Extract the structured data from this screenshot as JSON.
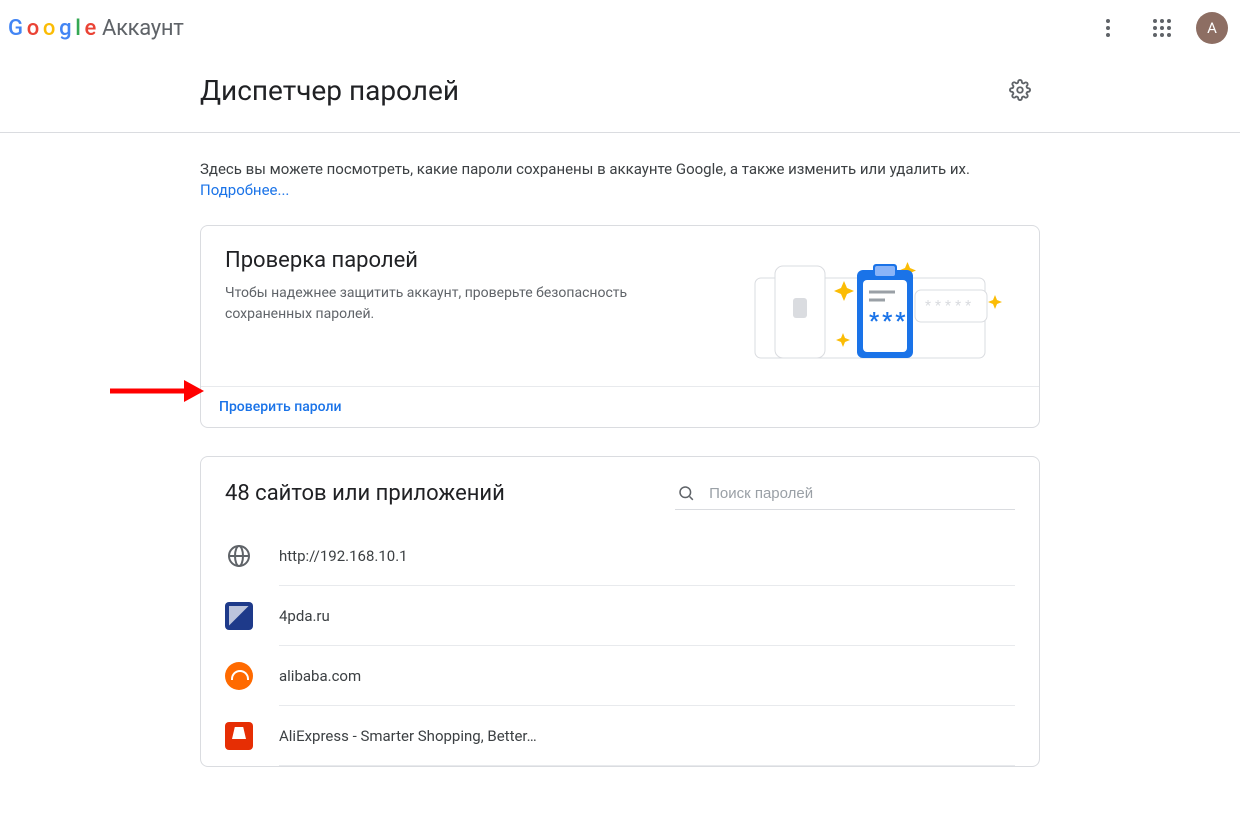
{
  "appbar": {
    "logo_letters": [
      "G",
      "o",
      "o",
      "g",
      "l",
      "e"
    ],
    "suffix": "Аккаунт",
    "avatar_initial": "А"
  },
  "header": {
    "title": "Диспетчер паролей"
  },
  "intro": {
    "text": "Здесь вы можете посмотреть, какие пароли сохранены в аккаунте Google, а также изменить или удалить их.",
    "more_link": "Подробнее..."
  },
  "checkup": {
    "title": "Проверка паролей",
    "description": "Чтобы надежнее защитить аккаунт, проверьте безопасность сохраненных паролей.",
    "action": "Проверить пароли"
  },
  "passwords": {
    "count": 48,
    "heading_template": "48 сайтов или приложений",
    "search_placeholder": "Поиск паролей",
    "items": [
      {
        "icon": "globe",
        "label": "http://192.168.10.1"
      },
      {
        "icon": "blue-sq",
        "label": "4pda.ru"
      },
      {
        "icon": "ali",
        "label": "alibaba.com"
      },
      {
        "icon": "aex",
        "label": "AliExpress - Smarter Shopping, Better…"
      }
    ]
  }
}
